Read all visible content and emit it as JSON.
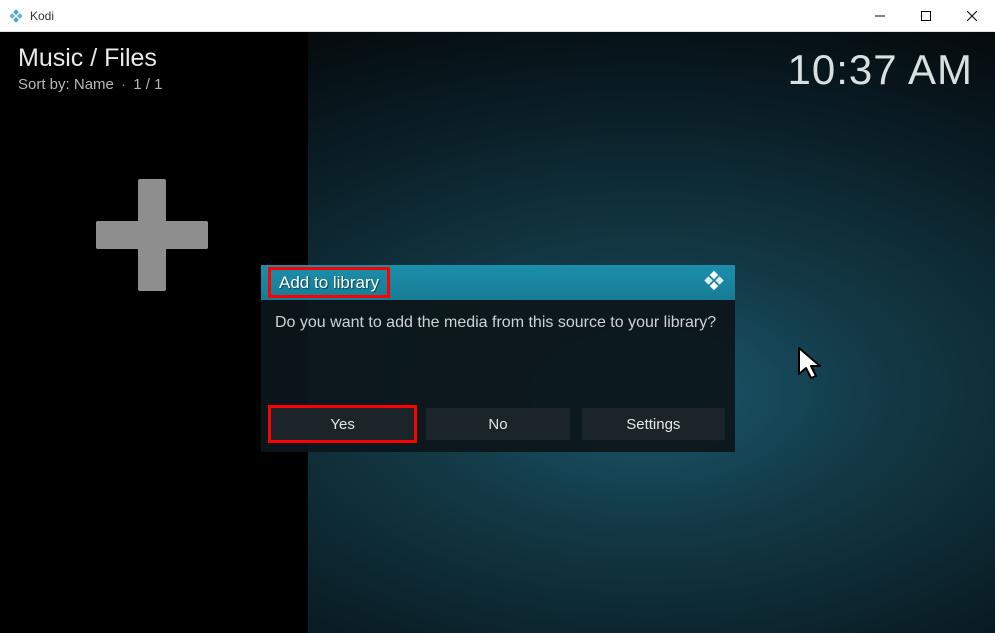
{
  "window": {
    "title": "Kodi"
  },
  "header": {
    "breadcrumb": "Music / Files",
    "sort_prefix": "Sort by:",
    "sort_value": "Name",
    "page_count": "1 / 1",
    "clock": "10:37 AM"
  },
  "dialog": {
    "title": "Add to library",
    "message": "Do you want to add the media from this source to your library?",
    "buttons": {
      "yes": "Yes",
      "no": "No",
      "settings": "Settings"
    }
  },
  "highlight": {
    "title_box": true,
    "yes_button": true
  }
}
